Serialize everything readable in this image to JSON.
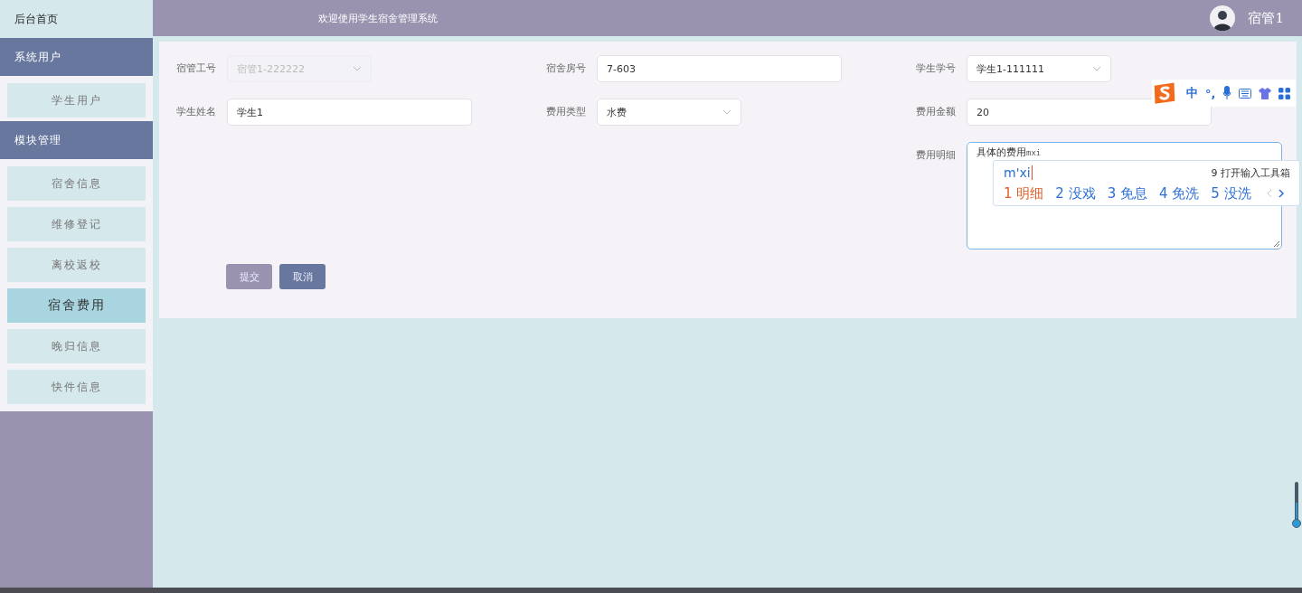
{
  "sidebar": {
    "home": "后台首页",
    "groups": [
      {
        "title": "系统用户",
        "items": [
          {
            "label": "学生用户",
            "selected": false
          }
        ]
      },
      {
        "title": "模块管理",
        "items": [
          {
            "label": "宿舍信息",
            "selected": false
          },
          {
            "label": "维修登记",
            "selected": false
          },
          {
            "label": "离校返校",
            "selected": false
          },
          {
            "label": "宿舍费用",
            "selected": true
          },
          {
            "label": "晚归信息",
            "selected": false
          },
          {
            "label": "快件信息",
            "selected": false
          }
        ]
      }
    ]
  },
  "header": {
    "title": "欢迎使用学生宿舍管理系统",
    "user": "宿管1"
  },
  "form": {
    "rows": [
      [
        {
          "label": "宿管工号",
          "kind": "select",
          "value": "宿管1-222222",
          "disabled": true
        },
        {
          "label": "宿舍房号",
          "kind": "input",
          "value": "7-603",
          "disabled": false
        },
        {
          "label": "学生学号",
          "kind": "select",
          "value": "学生1-111111",
          "disabled": false
        }
      ],
      [
        {
          "label": "学生姓名",
          "kind": "input",
          "value": "学生1",
          "disabled": false
        },
        {
          "label": "费用类型",
          "kind": "select",
          "value": "水费",
          "disabled": false
        },
        {
          "label": "费用金额",
          "kind": "input",
          "value": "20",
          "disabled": false
        }
      ],
      [
        null,
        null,
        {
          "label": "费用明细",
          "kind": "textarea",
          "value": "具体的费用",
          "composing": "mxi",
          "disabled": false
        }
      ]
    ],
    "buttons": [
      {
        "label": "提交",
        "kind": "submit"
      },
      {
        "label": "取消",
        "kind": "cancel"
      }
    ]
  },
  "ime": {
    "toolbar_mode": "中",
    "toolbar_punct": "°,",
    "composition": "m'xi",
    "tool_hint": "9 打开输入工具箱",
    "candidates": [
      {
        "index": "1",
        "word": "明细",
        "selected": true
      },
      {
        "index": "2",
        "word": "没戏",
        "selected": false
      },
      {
        "index": "3",
        "word": "免息",
        "selected": false
      },
      {
        "index": "4",
        "word": "免洗",
        "selected": false
      },
      {
        "index": "5",
        "word": "没洗",
        "selected": false
      }
    ]
  }
}
